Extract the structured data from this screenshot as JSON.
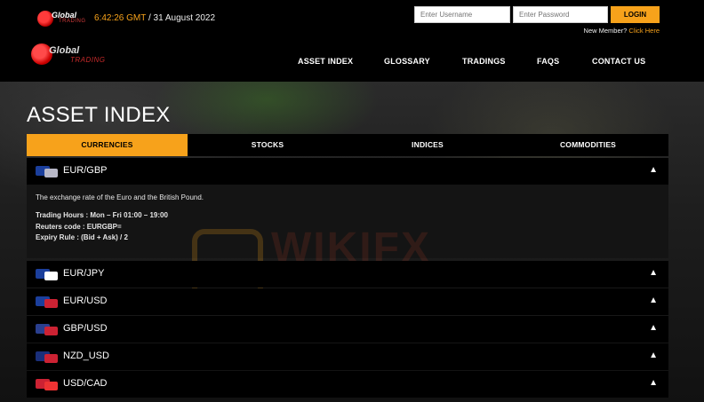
{
  "header": {
    "small_logo": {
      "line1": "Global",
      "line2": "TRADING"
    },
    "clock": {
      "time": "6:42:26 GMT",
      "separator": " / ",
      "date": "31 August 2022"
    },
    "login": {
      "username_placeholder": "Enter Username",
      "password_placeholder": "Enter Password",
      "button": "LOGIN"
    },
    "new_member": {
      "text": "New Member? ",
      "link": "Click Here"
    }
  },
  "nav": {
    "logo": {
      "line1": "Global",
      "line2": "TRADING"
    },
    "items": [
      "ASSET INDEX",
      "GLOSSARY",
      "TRADINGS",
      "FAQS",
      "CONTACT US"
    ]
  },
  "page": {
    "title": "ASSET INDEX"
  },
  "tabs": [
    "CURRENCIES",
    "STOCKS",
    "INDICES",
    "COMMODITIES"
  ],
  "accordion": {
    "expanded": {
      "label": "EUR/GBP",
      "description": "The exchange rate of the Euro and the British Pound.",
      "trading_hours": "Trading Hours : Mon – Fri 01:00 – 19:00",
      "reuters": "Reuters code : EURGBP=",
      "expiry": "Expiry Rule : (Bid + Ask) / 2"
    },
    "items": [
      "EUR/JPY",
      "EUR/USD",
      "GBP/USD",
      "NZD_USD",
      "USD/CAD"
    ]
  },
  "watermark": "WIKIFX",
  "colors": {
    "accent": "#f7a21b",
    "brand_red": "#c62a2a",
    "background": "#000000"
  }
}
